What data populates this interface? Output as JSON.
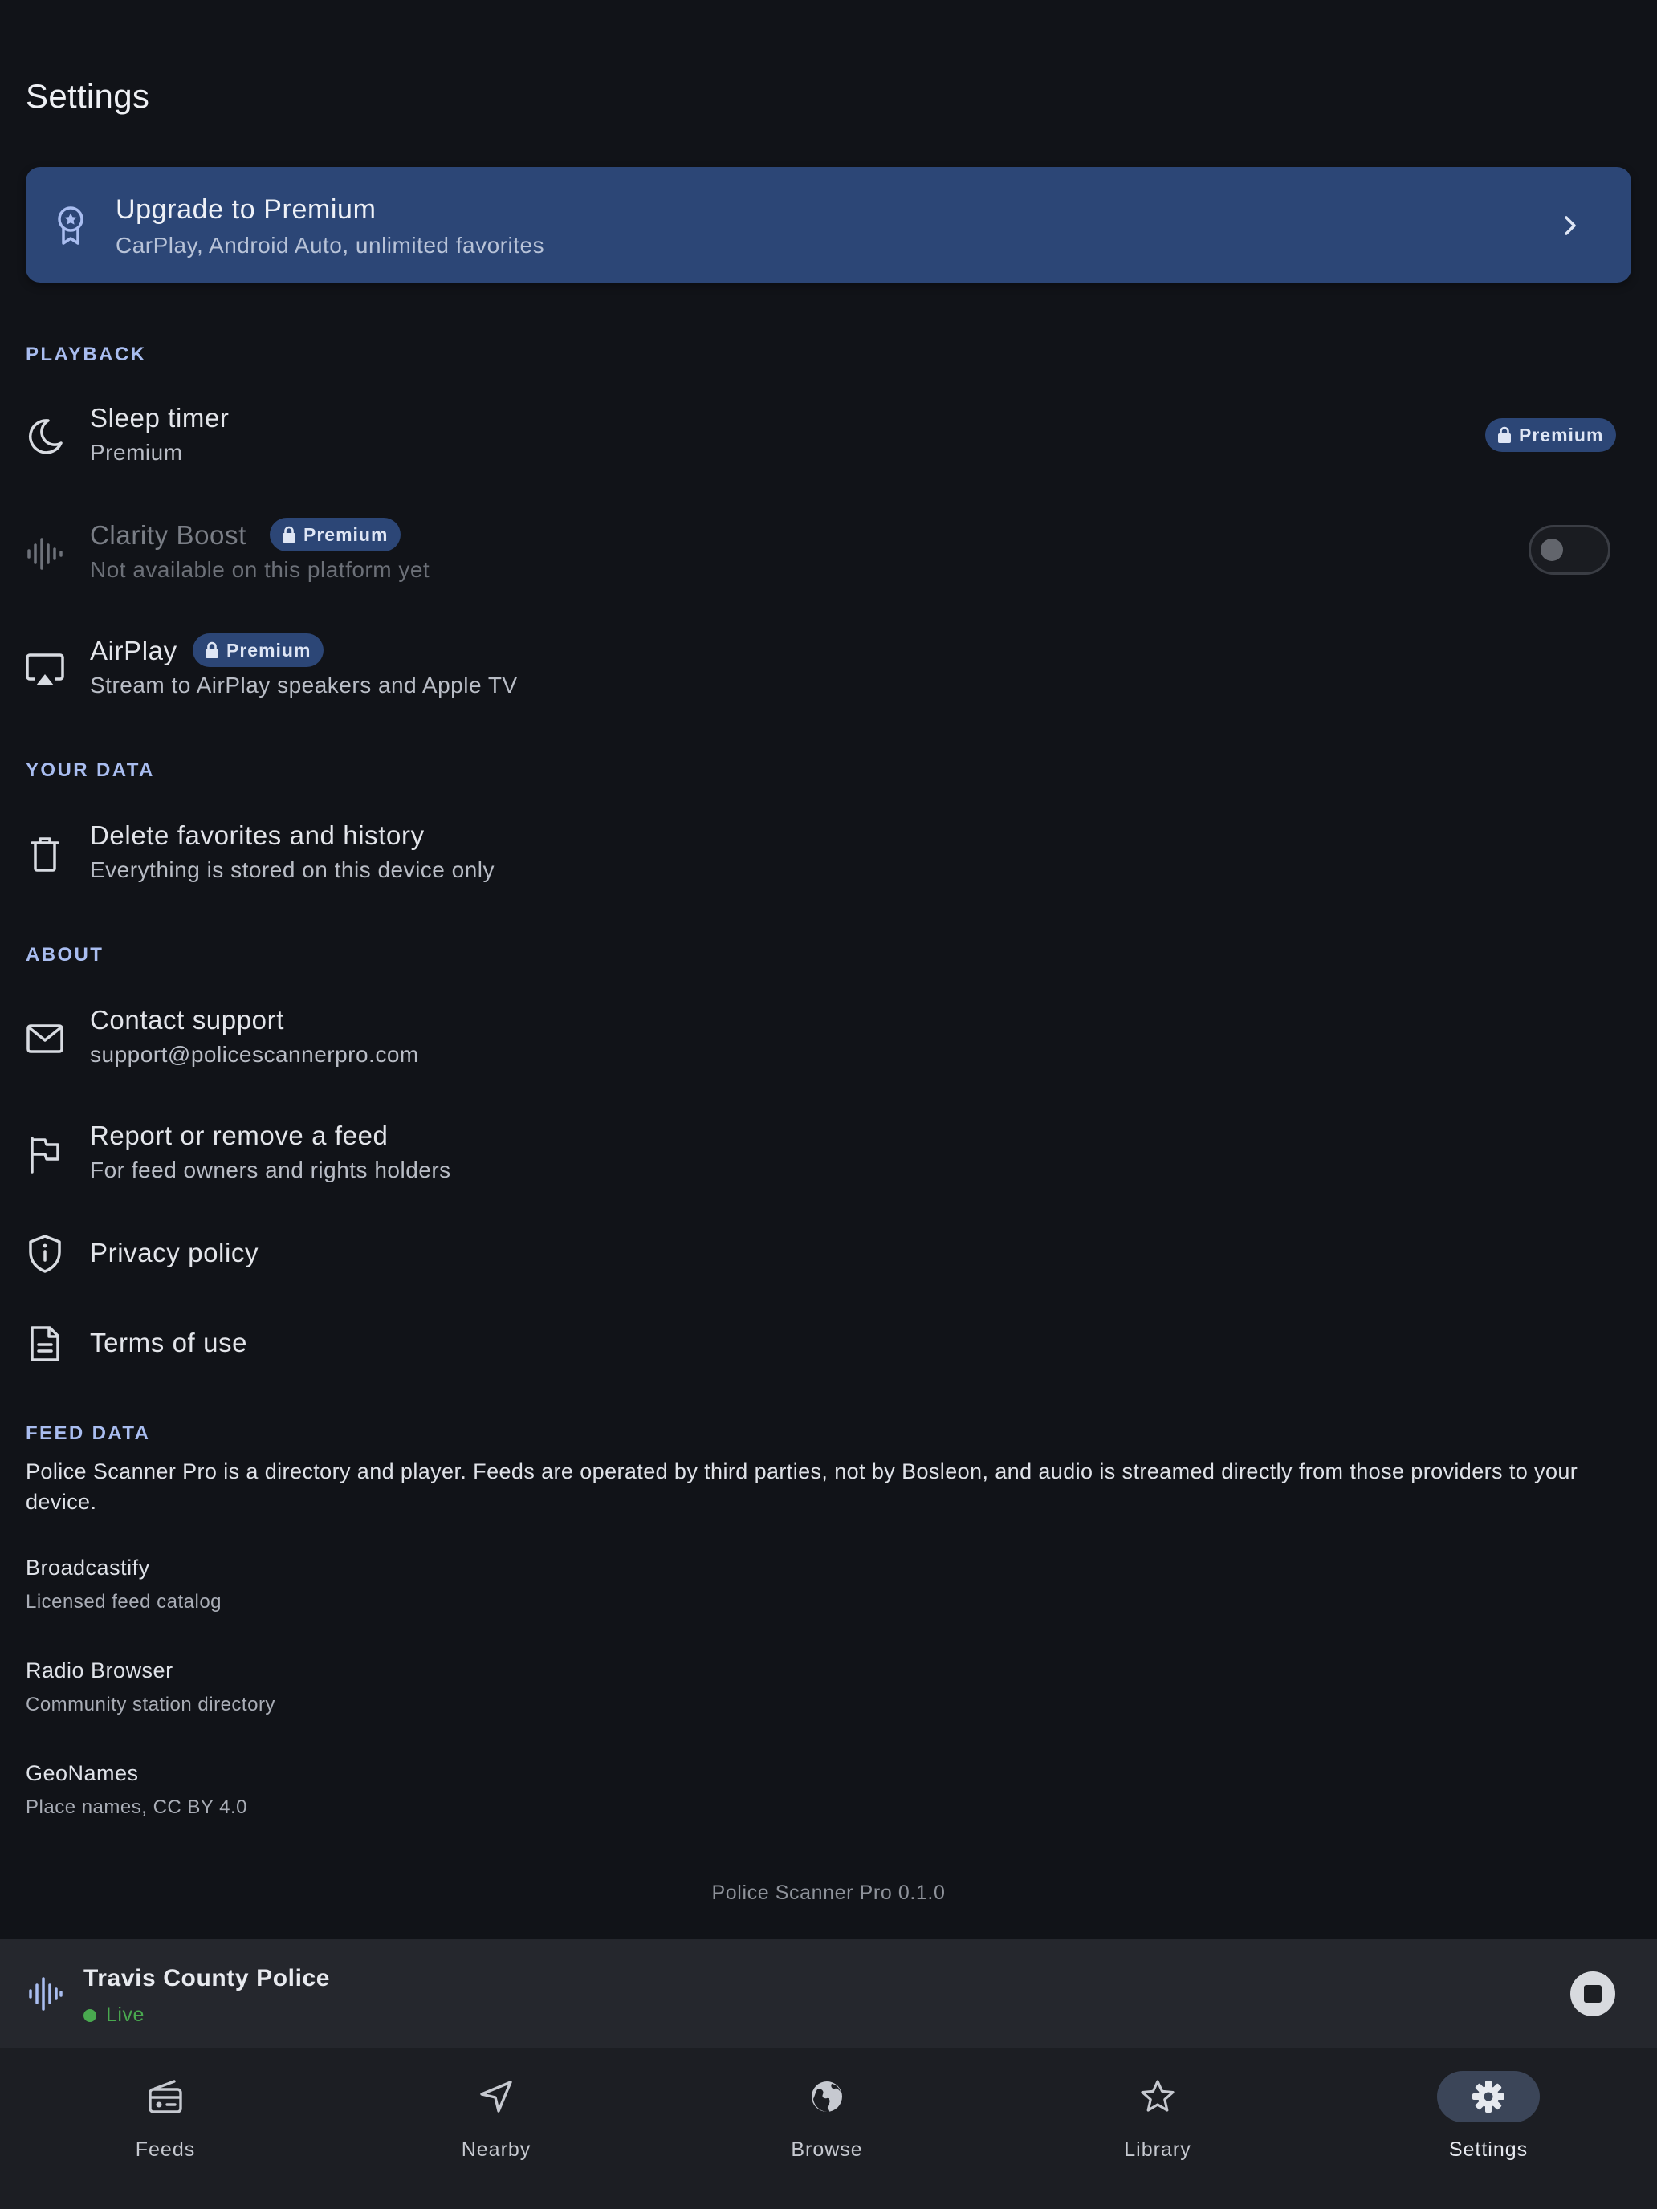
{
  "page": {
    "title": "Settings"
  },
  "premium_banner": {
    "title": "Upgrade to Premium",
    "subtitle": "CarPlay, Android Auto, unlimited favorites"
  },
  "sections": {
    "playback": "PLAYBACK",
    "your_data": "YOUR DATA",
    "about": "ABOUT",
    "feed_data": "FEED DATA"
  },
  "playback": {
    "sleep_timer": {
      "title": "Sleep timer",
      "subtitle": "Premium",
      "badge": "Premium"
    },
    "clarity_boost": {
      "title": "Clarity Boost",
      "subtitle": "Not available on this platform yet",
      "badge": "Premium",
      "enabled": false
    },
    "airplay": {
      "title": "AirPlay",
      "subtitle": "Stream to AirPlay speakers and Apple TV",
      "badge": "Premium"
    }
  },
  "your_data": {
    "delete": {
      "title": "Delete favorites and history",
      "subtitle": "Everything is stored on this device only"
    }
  },
  "about": {
    "contact": {
      "title": "Contact support",
      "subtitle": "support@policescannerpro.com"
    },
    "report": {
      "title": "Report or remove a feed",
      "subtitle": "For feed owners and rights holders"
    },
    "privacy": {
      "title": "Privacy policy"
    },
    "terms": {
      "title": "Terms of use"
    }
  },
  "feed_data": {
    "description": "Police Scanner Pro is a directory and player. Feeds are operated by third parties, not by Bosleon, and audio is streamed directly from those providers to your device.",
    "sources": [
      {
        "name": "Broadcastify",
        "description": "Licensed feed catalog"
      },
      {
        "name": "Radio Browser",
        "description": "Community station directory"
      },
      {
        "name": "GeoNames",
        "description": "Place names, CC BY 4.0"
      }
    ]
  },
  "version": "Police Scanner Pro 0.1.0",
  "now_playing": {
    "title": "Travis County Police",
    "status": "Live"
  },
  "nav": {
    "items": [
      {
        "label": "Feeds",
        "icon": "radio-icon"
      },
      {
        "label": "Nearby",
        "icon": "navigation-arrow-icon"
      },
      {
        "label": "Browse",
        "icon": "globe-icon"
      },
      {
        "label": "Library",
        "icon": "star-icon"
      },
      {
        "label": "Settings",
        "icon": "gear-icon"
      }
    ],
    "active": "Settings"
  },
  "colors": {
    "background": "#111318",
    "accent": "#2c4676",
    "accent_text": "#a9bdf0",
    "live": "#49a94f",
    "player_bar": "#25272d",
    "nav_bar": "#1c1e23"
  }
}
